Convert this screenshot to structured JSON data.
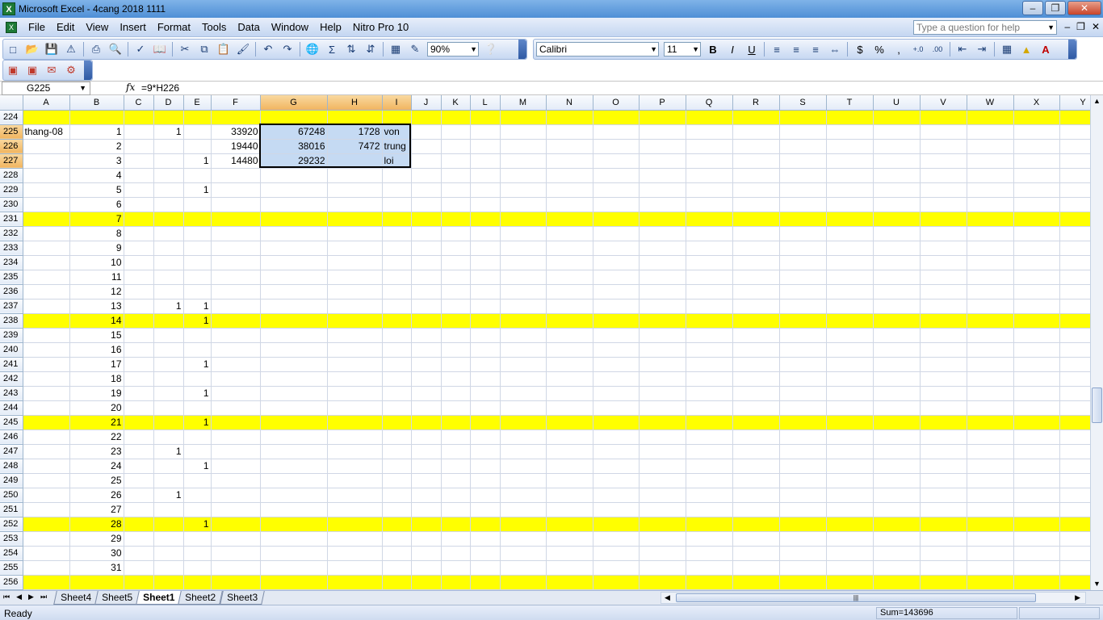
{
  "window": {
    "title": "Microsoft Excel - 4cang 2018 1111"
  },
  "menu": [
    "File",
    "Edit",
    "View",
    "Insert",
    "Format",
    "Tools",
    "Data",
    "Window",
    "Help",
    "Nitro Pro 10"
  ],
  "help_placeholder": "Type a question for help",
  "toolbar": {
    "zoom": "90%",
    "font": "Calibri",
    "font_size": "11"
  },
  "formula_bar": {
    "name_box": "G225",
    "fx": "fx",
    "formula": "=9*H226"
  },
  "columns": [
    "A",
    "B",
    "C",
    "D",
    "E",
    "F",
    "G",
    "H",
    "I",
    "J",
    "K",
    "L",
    "M",
    "N",
    "O",
    "P",
    "Q",
    "R",
    "S",
    "T",
    "U",
    "V",
    "W",
    "X",
    "Y"
  ],
  "rows": [
    {
      "n": "224",
      "yellow": true,
      "cells": {}
    },
    {
      "n": "225",
      "cells": {
        "A": "thang-08",
        "B": "1",
        "D": "1",
        "F": "33920",
        "G": "67248",
        "H": "1728",
        "I": "von"
      }
    },
    {
      "n": "226",
      "cells": {
        "B": "2",
        "F": "19440",
        "G": "38016",
        "H": "7472",
        "I": "trung"
      }
    },
    {
      "n": "227",
      "cells": {
        "B": "3",
        "E": "1",
        "F": "14480",
        "G": "29232",
        "I": "loi"
      }
    },
    {
      "n": "228",
      "cells": {
        "B": "4"
      }
    },
    {
      "n": "229",
      "cells": {
        "B": "5",
        "E": "1"
      }
    },
    {
      "n": "230",
      "cells": {
        "B": "6"
      }
    },
    {
      "n": "231",
      "yellow": true,
      "cells": {
        "B": "7"
      }
    },
    {
      "n": "232",
      "cells": {
        "B": "8"
      }
    },
    {
      "n": "233",
      "cells": {
        "B": "9"
      }
    },
    {
      "n": "234",
      "cells": {
        "B": "10"
      }
    },
    {
      "n": "235",
      "cells": {
        "B": "11"
      }
    },
    {
      "n": "236",
      "cells": {
        "B": "12"
      }
    },
    {
      "n": "237",
      "cells": {
        "B": "13",
        "D": "1",
        "E": "1"
      }
    },
    {
      "n": "238",
      "yellow": true,
      "cells": {
        "B": "14",
        "E": "1"
      }
    },
    {
      "n": "239",
      "cells": {
        "B": "15"
      }
    },
    {
      "n": "240",
      "cells": {
        "B": "16"
      }
    },
    {
      "n": "241",
      "cells": {
        "B": "17",
        "E": "1"
      }
    },
    {
      "n": "242",
      "cells": {
        "B": "18"
      }
    },
    {
      "n": "243",
      "cells": {
        "B": "19",
        "E": "1"
      }
    },
    {
      "n": "244",
      "cells": {
        "B": "20"
      }
    },
    {
      "n": "245",
      "yellow": true,
      "cells": {
        "B": "21",
        "E": "1"
      }
    },
    {
      "n": "246",
      "cells": {
        "B": "22"
      }
    },
    {
      "n": "247",
      "cells": {
        "B": "23",
        "D": "1"
      }
    },
    {
      "n": "248",
      "cells": {
        "B": "24",
        "E": "1"
      }
    },
    {
      "n": "249",
      "cells": {
        "B": "25"
      }
    },
    {
      "n": "250",
      "cells": {
        "B": "26",
        "D": "1"
      }
    },
    {
      "n": "251",
      "cells": {
        "B": "27"
      }
    },
    {
      "n": "252",
      "yellow": true,
      "cells": {
        "B": "28",
        "E": "1"
      }
    },
    {
      "n": "253",
      "cells": {
        "B": "29"
      }
    },
    {
      "n": "254",
      "cells": {
        "B": "30"
      }
    },
    {
      "n": "255",
      "cells": {
        "B": "31"
      }
    },
    {
      "n": "256",
      "yellow": true,
      "cells": {}
    }
  ],
  "selection": {
    "cols": [
      "G",
      "H",
      "I"
    ],
    "rows": [
      "225",
      "226",
      "227"
    ]
  },
  "sheet_tabs": [
    "Sheet4",
    "Sheet5",
    "Sheet1",
    "Sheet2",
    "Sheet3"
  ],
  "active_tab": "Sheet1",
  "status": {
    "ready": "Ready",
    "sum": "Sum=143696"
  },
  "colors": {
    "highlight_row": "#ffff00",
    "selection": "#c5daf3"
  }
}
